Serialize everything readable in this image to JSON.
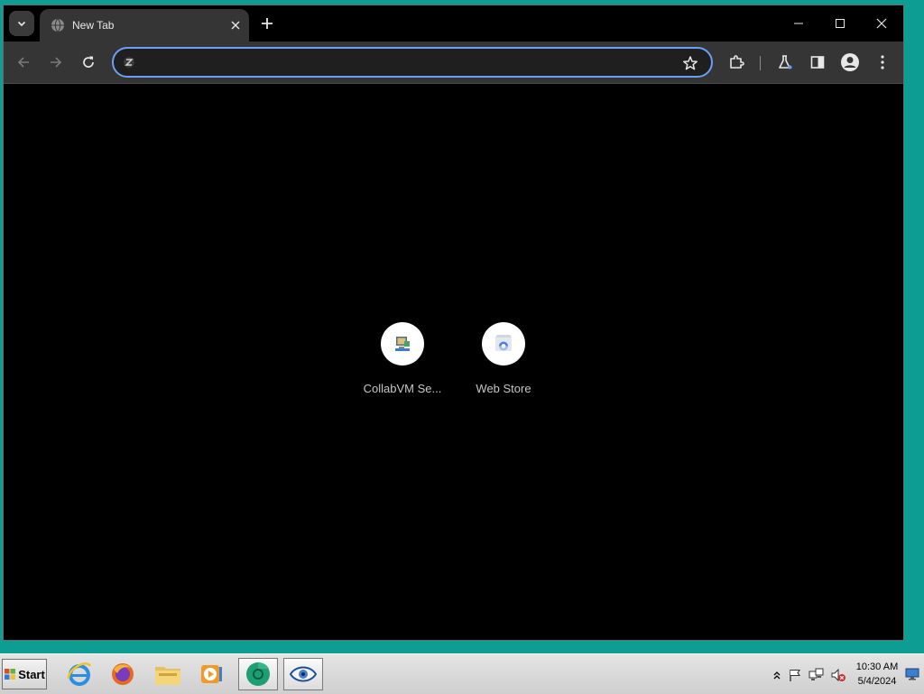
{
  "browser": {
    "tab": {
      "title": "New Tab",
      "favicon": "globe-icon"
    },
    "omnibox": {
      "value": "",
      "placeholder": ""
    },
    "accent_color": "#6b9ef5"
  },
  "shortcuts": [
    {
      "label": "CollabVM Se...",
      "icon": "collabvm-icon"
    },
    {
      "label": "Web Store",
      "icon": "webstore-icon"
    }
  ],
  "taskbar": {
    "start_label": "Start",
    "apps": [
      {
        "name": "internet-explorer-icon"
      },
      {
        "name": "firefox-icon"
      },
      {
        "name": "file-explorer-icon"
      },
      {
        "name": "media-player-icon"
      },
      {
        "name": "chrome-icon"
      },
      {
        "name": "eye-icon"
      }
    ],
    "clock": {
      "time": "10:30 AM",
      "date": "5/4/2024"
    }
  },
  "colors": {
    "desktop": "#0e9d93",
    "toolbar": "#353535",
    "content_background": "#000000"
  }
}
